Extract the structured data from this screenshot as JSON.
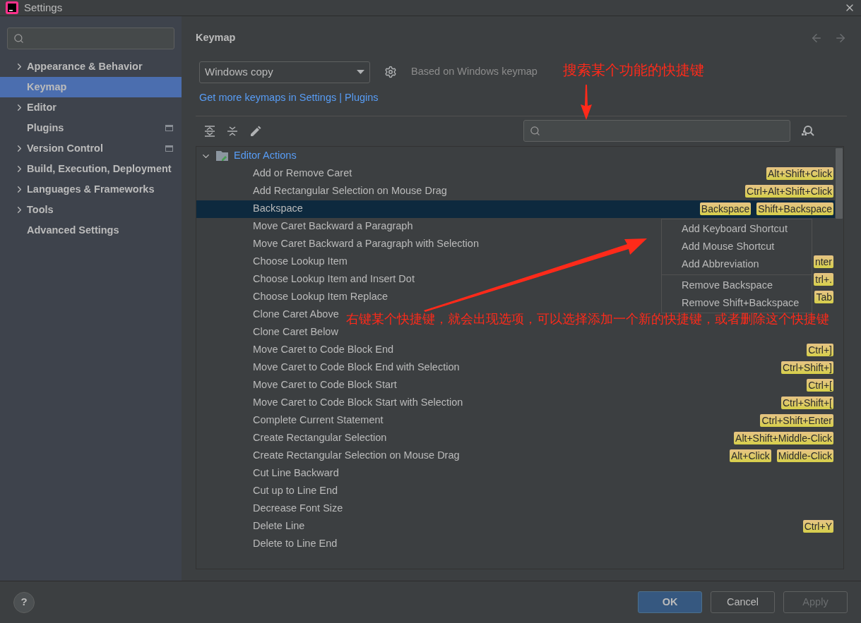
{
  "window": {
    "title": "Settings"
  },
  "sidebar": {
    "items": [
      {
        "label": "Appearance & Behavior",
        "expandable": true,
        "selected": false,
        "badge": false
      },
      {
        "label": "Keymap",
        "expandable": false,
        "selected": true,
        "badge": false
      },
      {
        "label": "Editor",
        "expandable": true,
        "selected": false,
        "badge": false
      },
      {
        "label": "Plugins",
        "expandable": false,
        "selected": false,
        "badge": true
      },
      {
        "label": "Version Control",
        "expandable": true,
        "selected": false,
        "badge": true
      },
      {
        "label": "Build, Execution, Deployment",
        "expandable": true,
        "selected": false,
        "badge": false
      },
      {
        "label": "Languages & Frameworks",
        "expandable": true,
        "selected": false,
        "badge": false
      },
      {
        "label": "Tools",
        "expandable": true,
        "selected": false,
        "badge": false
      },
      {
        "label": "Advanced Settings",
        "expandable": false,
        "selected": false,
        "badge": false
      }
    ]
  },
  "page": {
    "title": "Keymap",
    "keymap_select": "Windows copy",
    "based_on": "Based on Windows keymap",
    "link_text": "Get more keymaps in Settings",
    "link_separator": "|",
    "link_plugins": "Plugins"
  },
  "tree": {
    "group": {
      "label": "Editor Actions",
      "expanded": true
    },
    "rows": [
      {
        "name": "Add or Remove Caret",
        "selected": false,
        "shortcuts": [
          "Alt+Shift+Click"
        ]
      },
      {
        "name": "Add Rectangular Selection on Mouse Drag",
        "selected": false,
        "shortcuts": [
          "Ctrl+Alt+Shift+Click"
        ]
      },
      {
        "name": "Backspace",
        "selected": true,
        "shortcuts": [
          "Backspace",
          "Shift+Backspace"
        ]
      },
      {
        "name": "Move Caret Backward a Paragraph",
        "selected": false,
        "shortcuts": []
      },
      {
        "name": "Move Caret Backward a Paragraph with Selection",
        "selected": false,
        "shortcuts": []
      },
      {
        "name": "Choose Lookup Item",
        "selected": false,
        "shortcuts": [
          "nter"
        ]
      },
      {
        "name": "Choose Lookup Item and Insert Dot",
        "selected": false,
        "shortcuts": [
          "trl+."
        ]
      },
      {
        "name": "Choose Lookup Item Replace",
        "selected": false,
        "shortcuts": [
          "Tab"
        ]
      },
      {
        "name": "Clone Caret Above",
        "selected": false,
        "shortcuts": []
      },
      {
        "name": "Clone Caret Below",
        "selected": false,
        "shortcuts": []
      },
      {
        "name": "Move Caret to Code Block End",
        "selected": false,
        "shortcuts": [
          "Ctrl+]"
        ]
      },
      {
        "name": "Move Caret to Code Block End with Selection",
        "selected": false,
        "shortcuts": [
          "Ctrl+Shift+]"
        ]
      },
      {
        "name": "Move Caret to Code Block Start",
        "selected": false,
        "shortcuts": [
          "Ctrl+["
        ]
      },
      {
        "name": "Move Caret to Code Block Start with Selection",
        "selected": false,
        "shortcuts": [
          "Ctrl+Shift+["
        ]
      },
      {
        "name": "Complete Current Statement",
        "selected": false,
        "shortcuts": [
          "Ctrl+Shift+Enter"
        ]
      },
      {
        "name": "Create Rectangular Selection",
        "selected": false,
        "shortcuts": [
          "Alt+Shift+Middle-Click"
        ]
      },
      {
        "name": "Create Rectangular Selection on Mouse Drag",
        "selected": false,
        "shortcuts": [
          "Alt+Click",
          "Middle-Click"
        ]
      },
      {
        "name": "Cut Line Backward",
        "selected": false,
        "shortcuts": []
      },
      {
        "name": "Cut up to Line End",
        "selected": false,
        "shortcuts": []
      },
      {
        "name": "Decrease Font Size",
        "selected": false,
        "shortcuts": []
      },
      {
        "name": "Delete Line",
        "selected": false,
        "shortcuts": [
          "Ctrl+Y"
        ]
      },
      {
        "name": "Delete to Line End",
        "selected": false,
        "shortcuts": []
      }
    ]
  },
  "context_menu": {
    "sections": [
      [
        "Add Keyboard Shortcut",
        "Add Mouse Shortcut",
        "Add Abbreviation"
      ],
      [
        "Remove Backspace",
        "Remove Shift+Backspace"
      ]
    ]
  },
  "annotations": [
    "搜索某个功能的快捷键",
    "右键某个快捷键，就会出现选项，可以选择添加一个新的快捷键，或者删除这个快捷键"
  ],
  "buttons": [
    {
      "label": "OK",
      "kind": "primary",
      "disabled": false
    },
    {
      "label": "Cancel",
      "kind": "normal",
      "disabled": false
    },
    {
      "label": "Apply",
      "kind": "normal",
      "disabled": true
    }
  ],
  "help": "?"
}
